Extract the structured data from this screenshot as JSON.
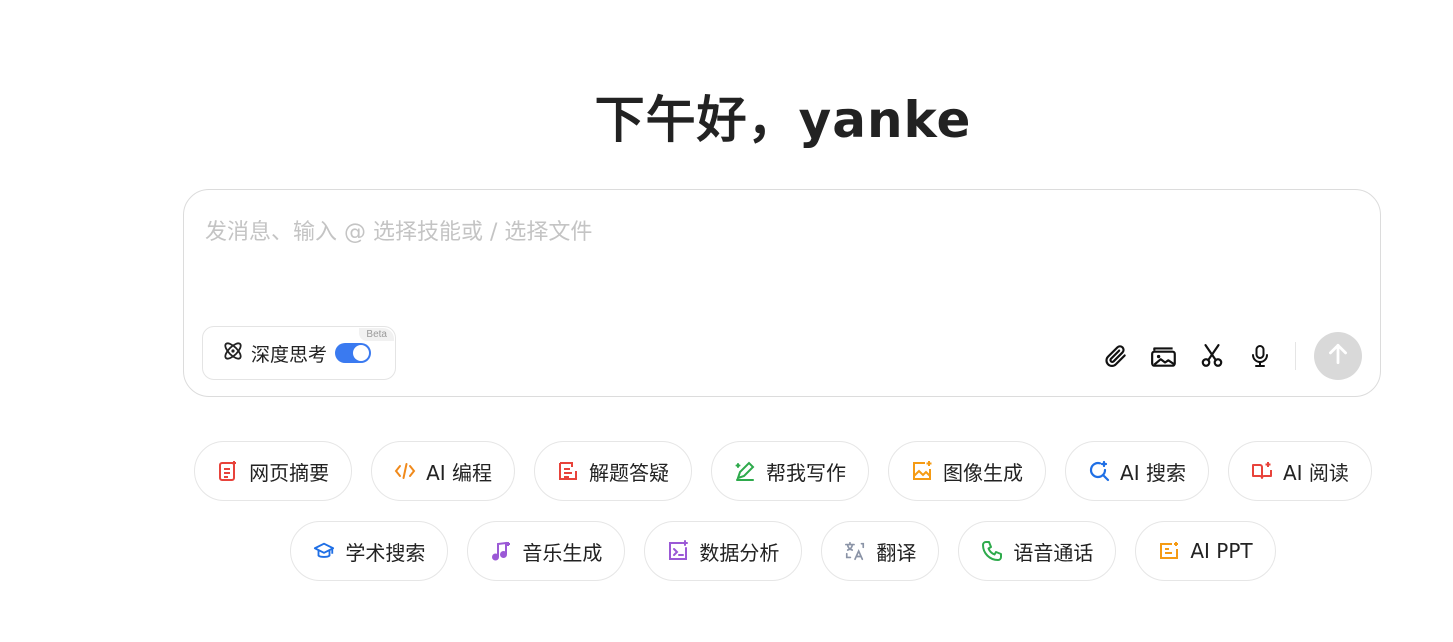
{
  "greeting": "下午好，yanke",
  "composer": {
    "placeholder": "发消息、输入 @ 选择技能或 / 选择文件",
    "value": "",
    "deep_think": {
      "label": "深度思考",
      "badge": "Beta",
      "enabled": true
    },
    "tools": [
      {
        "icon": "paperclip-icon"
      },
      {
        "icon": "image-icon"
      },
      {
        "icon": "scissors-icon"
      },
      {
        "icon": "microphone-icon"
      }
    ],
    "send_icon": "arrow-up-icon"
  },
  "skills_row1": [
    {
      "label": "网页摘要",
      "icon": "web-summary-icon",
      "color": "#e8433b"
    },
    {
      "label": "AI 编程",
      "icon": "code-icon",
      "color": "#f08a1c"
    },
    {
      "label": "解题答疑",
      "icon": "solve-icon",
      "color": "#e8433b"
    },
    {
      "label": "帮我写作",
      "icon": "pen-icon",
      "color": "#2eaa4c"
    },
    {
      "label": "图像生成",
      "icon": "image-gen-icon",
      "color": "#f59b14"
    },
    {
      "label": "AI 搜索",
      "icon": "search-icon",
      "color": "#1f6fe5"
    },
    {
      "label": "AI 阅读",
      "icon": "book-icon",
      "color": "#e8433b"
    }
  ],
  "skills_row2": [
    {
      "label": "学术搜索",
      "icon": "graduation-cap-icon",
      "color": "#1f6fe5"
    },
    {
      "label": "音乐生成",
      "icon": "music-icon",
      "color": "#9b59d6"
    },
    {
      "label": "数据分析",
      "icon": "terminal-icon",
      "color": "#9b59d6"
    },
    {
      "label": "翻译",
      "icon": "translate-icon",
      "color": "#8a93a6"
    },
    {
      "label": "语音通话",
      "icon": "phone-icon",
      "color": "#2eaa4c"
    },
    {
      "label": "AI PPT",
      "icon": "ppt-icon",
      "color": "#f59b14"
    }
  ]
}
